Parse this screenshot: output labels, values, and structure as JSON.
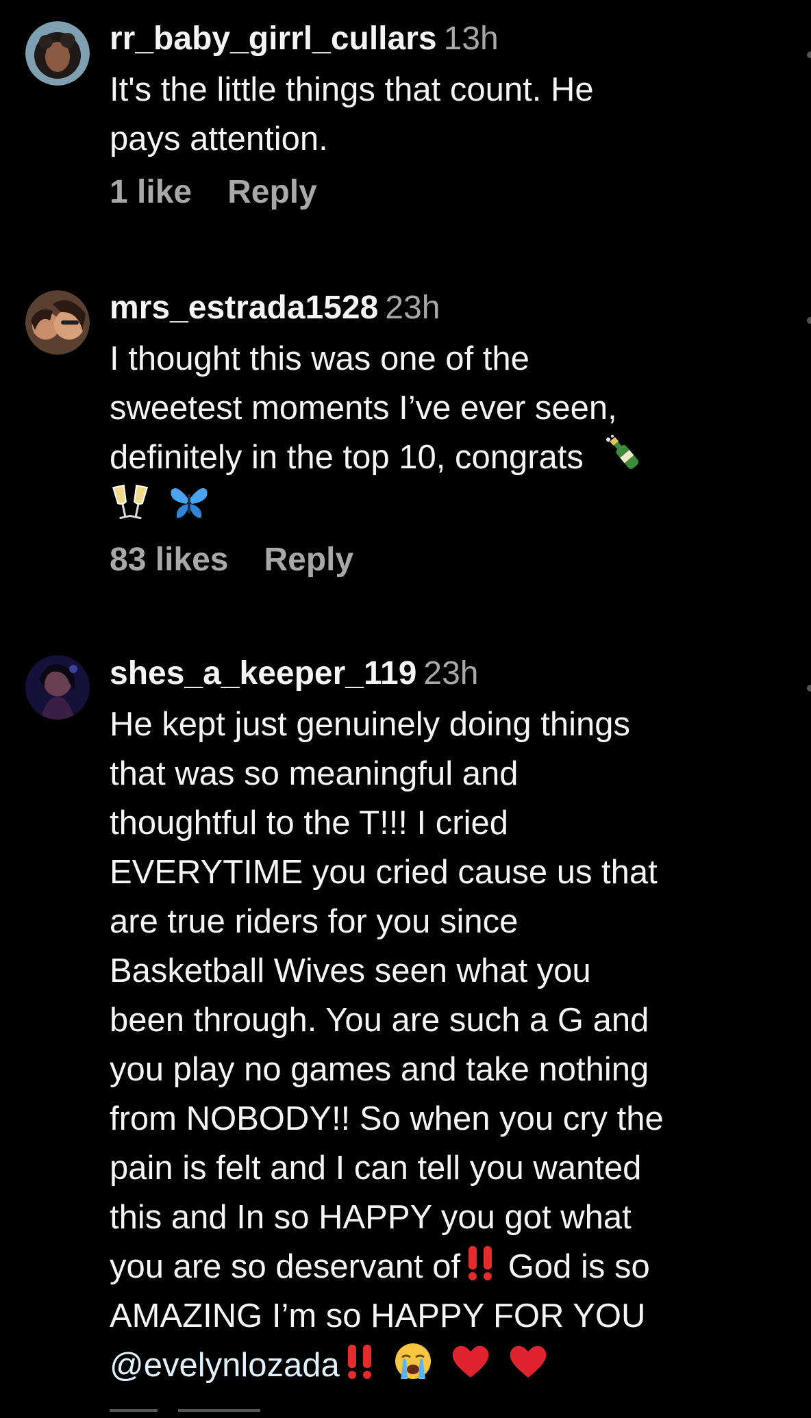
{
  "comments": [
    {
      "username": "rr_baby_girrl_cullars",
      "time": "13h",
      "lines": [
        "It's the little things that count. He",
        "pays attention."
      ],
      "likes": "1 like",
      "reply": "Reply"
    },
    {
      "username": "mrs_estrada1528",
      "time": "23h",
      "lines": [
        "I thought this was one of the",
        "sweetest moments I’ve ever seen,",
        "definitely in the top 10, congrats"
      ],
      "likes": "83 likes",
      "reply": "Reply"
    },
    {
      "username": "shes_a_keeper_119",
      "time": "23h",
      "lines": [
        "He kept just genuinely doing things",
        "that was so meaningful and",
        "thoughtful to the T!!! I cried",
        "EVERYTIME you cried cause us that",
        "are true riders for you since",
        "Basketball Wives seen what you",
        "been through. You are such a G and",
        "you play no games and take nothing",
        "from NOBODY!! So when you cry the",
        "pain is felt and I can tell you wanted",
        "this and In so HAPPY you got what",
        "you are so deservant of",
        "God is so",
        "AMAZING  I’m so HAPPY FOR YOU",
        "@evelynlozada"
      ]
    }
  ],
  "icons": {
    "champagne": "champagne-bottle-icon",
    "glasses": "clinking-glasses-icon",
    "butterfly": "butterfly-icon",
    "exclamation": "double-exclamation-icon",
    "crying": "crying-face-icon",
    "heart": "red-heart-icon"
  },
  "colors": {
    "background": "#000000",
    "text": "#f5f5f5",
    "secondary": "#a8a8a8",
    "heart": "#e0242f",
    "exclamation": "#e52b2b"
  }
}
